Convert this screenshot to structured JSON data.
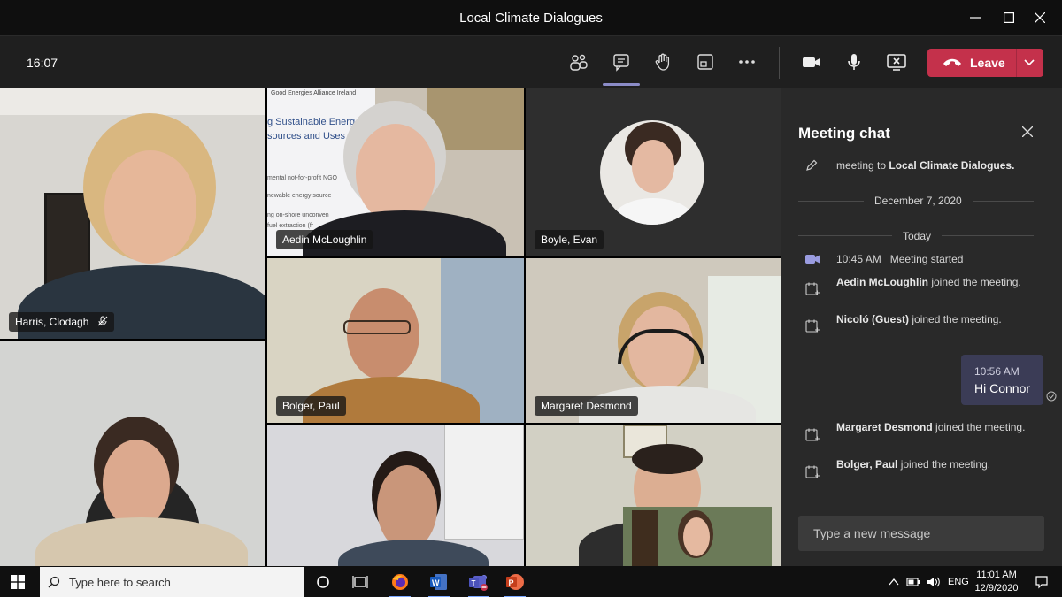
{
  "window": {
    "title": "Local Climate Dialogues"
  },
  "toolbar": {
    "clock": "16:07",
    "leave_label": "Leave"
  },
  "participants": [
    {
      "name": "Harris, Clodagh",
      "muted": true
    },
    {
      "name": "Aedin McLoughlin"
    },
    {
      "name": "Boyle, Evan"
    },
    {
      "name": "Bolger, Paul"
    },
    {
      "name": "Margaret Desmond"
    }
  ],
  "poster": {
    "line1": "Good Energies Alliance Ireland",
    "line2": "g Sustainable Energ",
    "line3": "sources and Uses",
    "line4": "mental not-for-profit NGO",
    "line5": "newable energy source",
    "line6": "ng on-shore unconven",
    "line7": "fuel extraction (fr"
  },
  "chat": {
    "title": "Meeting chat",
    "rename_prefix": "meeting to ",
    "rename_target": "Local Climate Dialogues.",
    "date_divider": "December 7, 2020",
    "today_divider": "Today",
    "meeting_started_time": "10:45 AM",
    "meeting_started_text": "Meeting started",
    "events": [
      {
        "who": "Aedin McLoughlin",
        "text": " joined the meeting."
      },
      {
        "who": "Nicoló (Guest)",
        "text": " joined the meeting."
      },
      {
        "who": "Margaret Desmond",
        "text": " joined the meeting."
      },
      {
        "who": "Bolger, Paul",
        "text": " joined the meeting."
      }
    ],
    "my_message": {
      "time": "10:56 AM",
      "text": "Hi Connor"
    },
    "compose_placeholder": "Type a new message"
  },
  "taskbar": {
    "search_placeholder": "Type here to search",
    "lang": "ENG",
    "time": "11:01 AM",
    "date": "12/9/2020"
  },
  "colors": {
    "leave": "#c4314b",
    "chat_bg": "#292929",
    "bubble": "#3b3c56",
    "accent": "#8b8cc7"
  }
}
